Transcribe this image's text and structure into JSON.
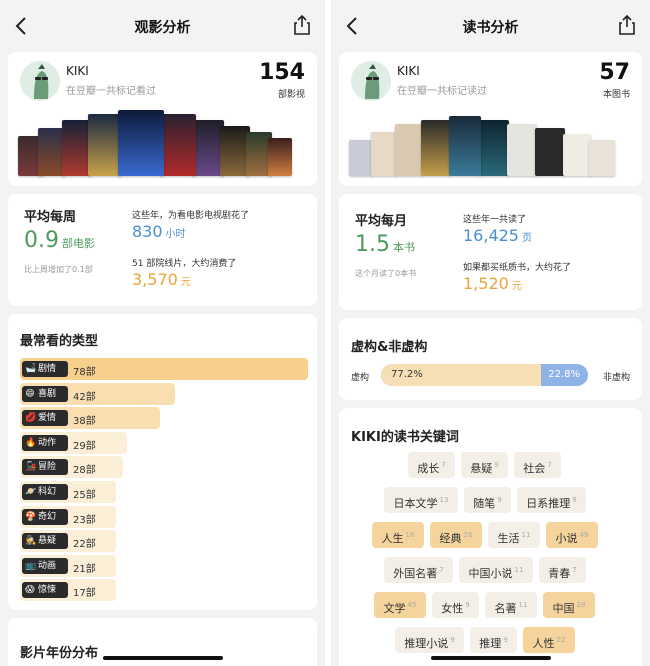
{
  "left": {
    "nav": {
      "title": "观影分析"
    },
    "profile": {
      "name": "KIKI",
      "subtitle": "在豆瓣一共标记看过",
      "count": "154",
      "unit": "部影视"
    },
    "stats": {
      "avg_label": "平均每周",
      "avg_value": "0.9",
      "avg_unit": "部电影",
      "avg_note": "比上周增加了0.1部",
      "spent_time_label": "这些年，为看电影电视剧花了",
      "spent_time_value": "830",
      "spent_time_unit": "小时",
      "spent_money_label": "51 部院线片，大约消费了",
      "spent_money_value": "3,570",
      "spent_money_unit": "元"
    },
    "genres": {
      "title": "最常看的类型",
      "items": [
        {
          "emoji": "🛁",
          "name": "剧情",
          "count": "78部",
          "value": 78
        },
        {
          "emoji": "😄",
          "name": "喜剧",
          "count": "42部",
          "value": 42
        },
        {
          "emoji": "💋",
          "name": "爱情",
          "count": "38部",
          "value": 38
        },
        {
          "emoji": "🔥",
          "name": "动作",
          "count": "29部",
          "value": 29
        },
        {
          "emoji": "🚂",
          "name": "冒险",
          "count": "28部",
          "value": 28
        },
        {
          "emoji": "🪐",
          "name": "科幻",
          "count": "25部",
          "value": 25
        },
        {
          "emoji": "🍄",
          "name": "奇幻",
          "count": "23部",
          "value": 23
        },
        {
          "emoji": "🕵️",
          "name": "悬疑",
          "count": "22部",
          "value": 22
        },
        {
          "emoji": "📺",
          "name": "动画",
          "count": "21部",
          "value": 21
        },
        {
          "emoji": "😱",
          "name": "惊悚",
          "count": "17部",
          "value": 17
        }
      ]
    },
    "year_title": "影片年份分布"
  },
  "right": {
    "nav": {
      "title": "读书分析"
    },
    "profile": {
      "name": "KIKI",
      "subtitle": "在豆瓣一共标记读过",
      "count": "57",
      "unit": "本图书"
    },
    "stats": {
      "avg_label": "平均每月",
      "avg_value": "1.5",
      "avg_unit": "本书",
      "avg_note": "这个月读了0本书",
      "total_label": "这些年一共读了",
      "total_value": "16,425",
      "total_unit": "页",
      "money_label": "如果都买纸质书，大约花了",
      "money_value": "1,520",
      "money_unit": "元"
    },
    "fiction": {
      "title": "虚构&非虚构",
      "left_label": "虚构",
      "right_label": "非虚构",
      "fiction_pct_text": "77.2%",
      "nonfiction_pct_text": "22.8%",
      "fiction_fraction": 0.772
    },
    "keywords": {
      "title": "KIKI的读书关键词",
      "rows": [
        [
          {
            "word": "成长",
            "n": "7"
          },
          {
            "word": "悬疑",
            "n": "9"
          },
          {
            "word": "社会",
            "n": "7"
          }
        ],
        [
          {
            "word": "日本文学",
            "n": "13"
          },
          {
            "word": "随笔",
            "n": "9"
          },
          {
            "word": "日系推理",
            "n": "9"
          }
        ],
        [
          {
            "word": "人生",
            "n": "16"
          },
          {
            "word": "经典",
            "n": "26"
          },
          {
            "word": "生活",
            "n": "11"
          },
          {
            "word": "小说",
            "n": "49"
          }
        ],
        [
          {
            "word": "外国名著",
            "n": "7"
          },
          {
            "word": "中国小说",
            "n": "11"
          },
          {
            "word": "青春",
            "n": "7"
          }
        ],
        [
          {
            "word": "文学",
            "n": "45"
          },
          {
            "word": "女性",
            "n": "9"
          },
          {
            "word": "名著",
            "n": "11"
          },
          {
            "word": "中国",
            "n": "28"
          }
        ],
        [
          {
            "word": "推理小说",
            "n": "9"
          },
          {
            "word": "推理",
            "n": "9"
          },
          {
            "word": "人性",
            "n": "22"
          }
        ]
      ]
    }
  },
  "colors": {
    "green": "#4e9a5c",
    "blue": "#4a8fd1",
    "orange": "#e8a53a",
    "bar_top": "#f6d08c",
    "bar_low": "#fbeed6"
  }
}
